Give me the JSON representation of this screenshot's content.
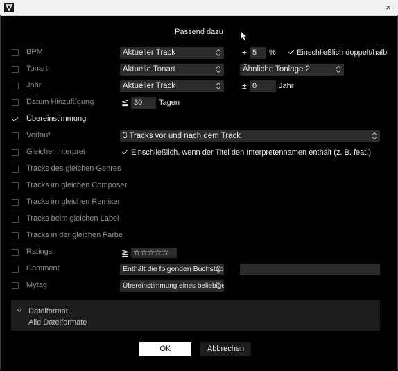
{
  "window": {
    "title": "Passend dazu",
    "close_icon": "×"
  },
  "rows": [
    {
      "label": "BPM",
      "checked": false
    },
    {
      "label": "Tonart",
      "checked": false
    },
    {
      "label": "Jahr",
      "checked": false
    },
    {
      "label": "Datum Hinzufügung",
      "checked": false
    },
    {
      "label": "Übereinstimmung",
      "checked": true
    },
    {
      "label": "Verlauf",
      "checked": false
    },
    {
      "label": "Gleicher Interpret",
      "checked": false
    },
    {
      "label": "Tracks des gleichen Genres",
      "checked": false
    },
    {
      "label": "Tracks im gleichen Composer",
      "checked": false
    },
    {
      "label": "Tracks im gleichen Remixer",
      "checked": false
    },
    {
      "label": "Tracks beim gleichen Label",
      "checked": false
    },
    {
      "label": "Tracks in der gleichen Farbe",
      "checked": false
    },
    {
      "label": "Ratings",
      "checked": false
    },
    {
      "label": "Comment",
      "checked": false
    },
    {
      "label": "Mytag",
      "checked": false
    }
  ],
  "bpm": {
    "select": "Aktueller Track",
    "pm": "±",
    "value": "5",
    "unit": "%",
    "option_checked": true,
    "option_label": "Einschließlich doppelt/halb"
  },
  "key": {
    "select": "Aktuelle Tonart",
    "select2": "Ähnliche Tonlage 2"
  },
  "year": {
    "select": "Aktueller Track",
    "pm": "±",
    "value": "0",
    "unit": "Jahr"
  },
  "date_added": {
    "symbol": "≦",
    "value": "30",
    "unit": "Tagen"
  },
  "history": {
    "select": "3 Tracks vor und nach dem Track"
  },
  "artist": {
    "option_checked": true,
    "option_label": "Einschließlich, wenn der Titel den Interpretennamen enthält (z. B. feat.)"
  },
  "ratings": {
    "symbol": "≧",
    "stars": "☆☆☆☆☆",
    "value": 0
  },
  "comment": {
    "select": "Enthält die folgenden Buchstaben",
    "value": ""
  },
  "mytag": {
    "select": "Übereinstimmung eines beliebigen ..."
  },
  "format_panel": {
    "title": "Dateiformat",
    "value": "Alle Dateiformate"
  },
  "buttons": {
    "ok": "OK",
    "cancel": "Abbrechen"
  },
  "icons": {
    "app": "app-logo-icon",
    "close": "close-icon",
    "chevron": "chevron-updown-icon",
    "collapse": "chevron-down-icon",
    "cursor": "mouse-pointer-icon"
  }
}
